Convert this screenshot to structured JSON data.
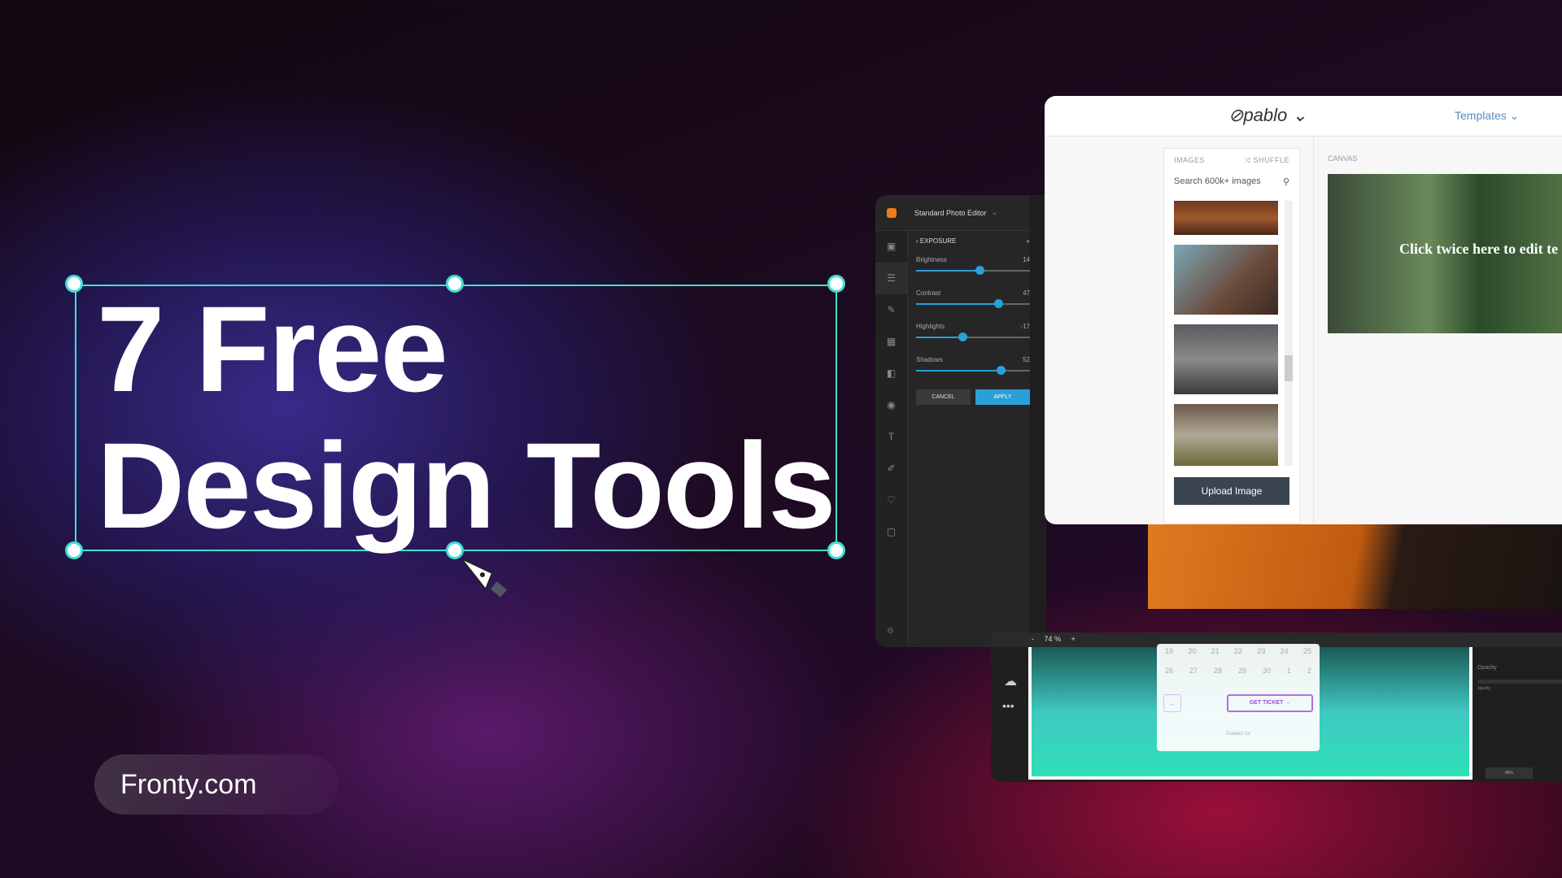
{
  "headline": {
    "line1": "7 Free",
    "line2": "Design Tools"
  },
  "site": "Fronty.com",
  "photo_editor": {
    "title": "Standard Photo Editor",
    "section": "EXPOSURE",
    "sliders": [
      {
        "label": "Brightness",
        "value": 14,
        "fraction": 0.56
      },
      {
        "label": "Contrast",
        "value": 47,
        "fraction": 0.72
      },
      {
        "label": "Highlights",
        "value": -17,
        "fraction": 0.41
      },
      {
        "label": "Shadows",
        "value": 52,
        "fraction": 0.74
      }
    ],
    "cancel": "CANCEL",
    "apply": "APPLY",
    "zoom": "74 %",
    "zoom_minus": "-",
    "zoom_plus": "+",
    "accent": "#2a9fd8"
  },
  "pablo": {
    "logo": "pablo",
    "templates": "Templates",
    "images_label": "IMAGES",
    "shuffle": "SHUFFLE",
    "search_placeholder": "Search 600k+ images",
    "upload": "Upload Image",
    "canvas_label": "CANVAS",
    "canvas_text": "Click twice here to edit te"
  },
  "lower_ui": {
    "row1": [
      "19",
      "20",
      "21",
      "22",
      "23",
      "24",
      "25"
    ],
    "row2": [
      "26",
      "27",
      "28",
      "29",
      "30",
      "1",
      "2"
    ],
    "get_ticket": "GET TICKET",
    "contact": "Contact Us",
    "opacity": "Opacity",
    "opacity_sub": "opacity",
    "pct": "88%"
  },
  "colors": {
    "selection": "#3fe0d0",
    "accent": "#2a9fd8",
    "ticket": "#a64be0"
  }
}
